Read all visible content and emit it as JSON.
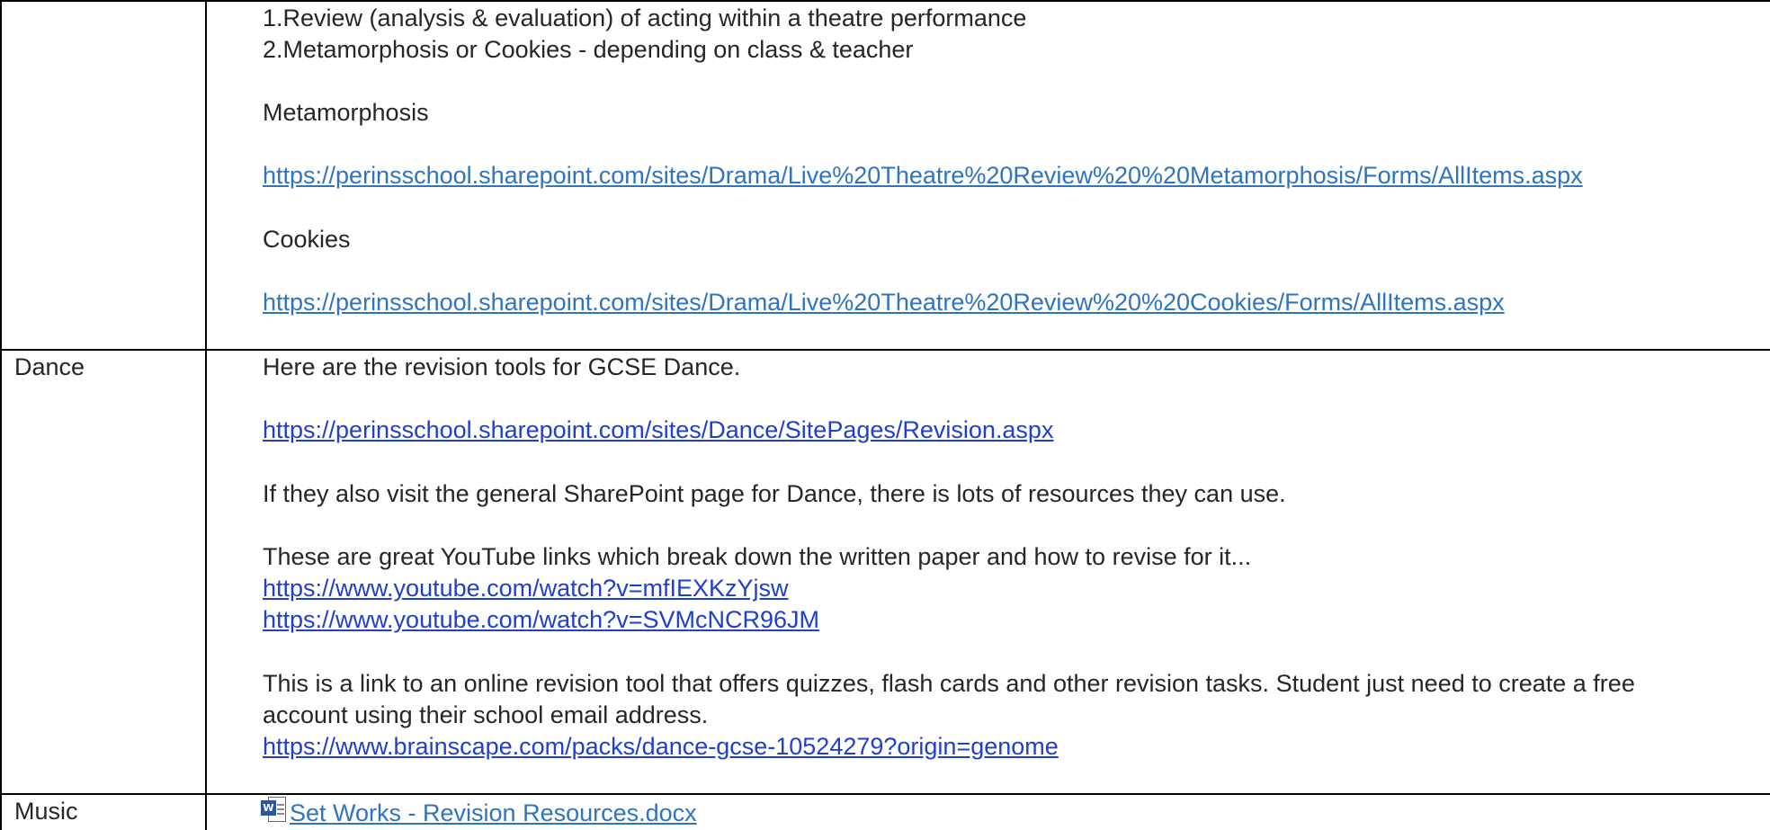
{
  "drama": {
    "line1": "1.Review (analysis & evaluation) of acting within a theatre performance",
    "line2": "2.Metamorphosis or Cookies - depending on class & teacher",
    "metamorphosis_heading": "Metamorphosis",
    "metamorphosis_link": "https://perinsschool.sharepoint.com/sites/Drama/Live%20Theatre%20Review%20%20Metamorphosis/Forms/AllItems.aspx",
    "cookies_heading": "Cookies",
    "cookies_link": "https://perinsschool.sharepoint.com/sites/Drama/Live%20Theatre%20Review%20%20Cookies/Forms/AllItems.aspx"
  },
  "dance": {
    "label": "Dance",
    "intro": "Here are the revision tools for GCSE Dance.",
    "revision_link": "https://perinsschool.sharepoint.com/sites/Dance/SitePages/Revision.aspx",
    "sharepoint_note": "If they also visit the general SharePoint page for Dance, there is lots of resources they can use.",
    "youtube_note": "These are great YouTube links which break down the written paper and how to revise for it...",
    "youtube_link_1": "https://www.youtube.com/watch?v=mfIEXKzYjsw",
    "youtube_link_2": "https://www.youtube.com/watch?v=SVMcNCR96JM",
    "brainscape_note_1": "This is a link to an online revision tool that offers quizzes, flash cards and other revision tasks. Student just need to create a free",
    "brainscape_note_2": "account using their school email address.",
    "brainscape_link": "https://www.brainscape.com/packs/dance-gcse-10524279?origin=genome"
  },
  "music": {
    "label": "Music",
    "file_icon": "word-document-icon",
    "file_link": "Set Works - Revision Resources.docx"
  },
  "colors": {
    "border": "#000000",
    "text": "#262626",
    "link_sharepoint": "#2e74c0",
    "link_other": "#1f3fd0",
    "word_badge": "#2b579a"
  }
}
